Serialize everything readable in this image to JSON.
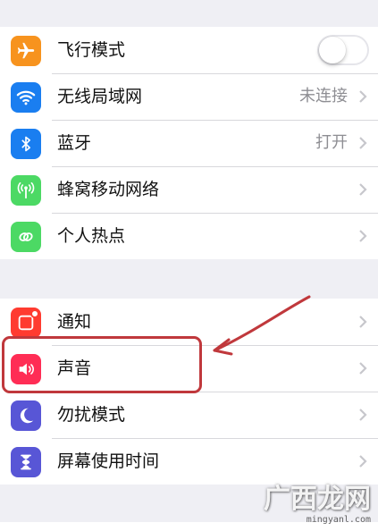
{
  "group1": {
    "items": [
      {
        "label": "飞行模式",
        "icon": "airplane-icon",
        "color": "#f7931e",
        "control": "toggle",
        "on": false
      },
      {
        "label": "无线局域网",
        "icon": "wifi-icon",
        "color": "#1a7ef0",
        "value": "未连接"
      },
      {
        "label": "蓝牙",
        "icon": "bluetooth-icon",
        "color": "#1a7ef0",
        "value": "打开"
      },
      {
        "label": "蜂窝移动网络",
        "icon": "cellular-antenna-icon",
        "color": "#4cd964"
      },
      {
        "label": "个人热点",
        "icon": "personal-hotspot-icon",
        "color": "#4cd964"
      }
    ]
  },
  "group2": {
    "items": [
      {
        "label": "通知",
        "icon": "notifications-icon",
        "color": "#ff3b30"
      },
      {
        "label": "声音",
        "icon": "speaker-icon",
        "color": "#ff2d55"
      },
      {
        "label": "勿扰模式",
        "icon": "moon-icon",
        "color": "#5856d6"
      },
      {
        "label": "屏幕使用时间",
        "icon": "hourglass-icon",
        "color": "#5856d6"
      }
    ]
  },
  "annotation": {
    "highlight_color": "#c0383c",
    "highlighted_item": "声音"
  },
  "watermark": {
    "main": "广西龙网",
    "sub": "mingyanl.com"
  }
}
